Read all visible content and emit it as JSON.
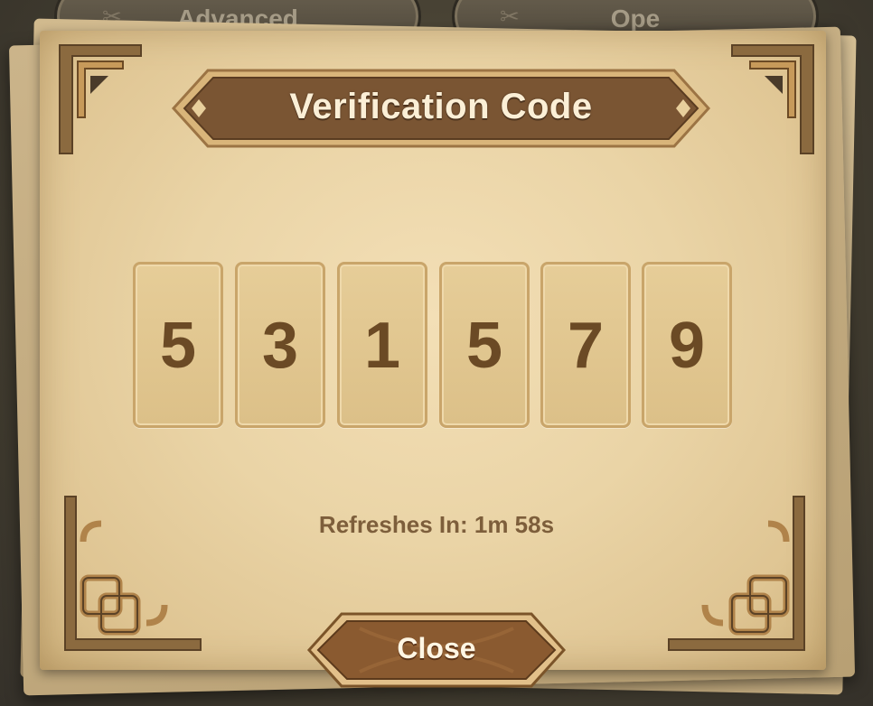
{
  "background_tabs": {
    "left_label": "Advanced",
    "right_label": "Ope",
    "left_icon": "tools-icon",
    "right_icon": "tools-icon"
  },
  "dialog": {
    "title": "Verification Code",
    "code_digits": [
      "5",
      "3",
      "1",
      "5",
      "7",
      "9"
    ],
    "refresh_text": "Refreshes In: 1m 58s",
    "close_label": "Close"
  },
  "colors": {
    "parchment": "#ead4a6",
    "banner": "#7a5533",
    "digit_text": "#6b4a25",
    "button": "#8a5a30"
  }
}
